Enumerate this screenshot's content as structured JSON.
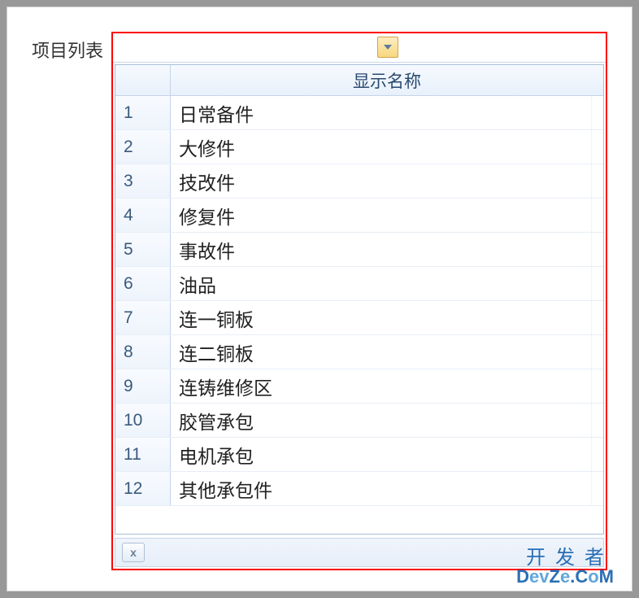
{
  "label": "项目列表",
  "combo": {
    "value": ""
  },
  "grid": {
    "header": {
      "display_name": "显示名称"
    },
    "rows": [
      {
        "idx": "1",
        "name": "日常备件"
      },
      {
        "idx": "2",
        "name": "大修件"
      },
      {
        "idx": "3",
        "name": "技改件"
      },
      {
        "idx": "4",
        "name": "修复件"
      },
      {
        "idx": "5",
        "name": "事故件"
      },
      {
        "idx": "6",
        "name": "油品"
      },
      {
        "idx": "7",
        "name": "连一铜板"
      },
      {
        "idx": "8",
        "name": "连二铜板"
      },
      {
        "idx": "9",
        "name": "连铸维修区"
      },
      {
        "idx": "10",
        "name": "胶管承包"
      },
      {
        "idx": "11",
        "name": "电机承包"
      },
      {
        "idx": "12",
        "name": "其他承包件"
      }
    ]
  },
  "footer": {
    "close_text": "x"
  },
  "watermark": {
    "line1": "开发者",
    "line2_a": "D",
    "line2_b": "ev",
    "line2_c": "Z",
    "line2_d": "e",
    "line2_e": ".C",
    "line2_f": "o",
    "line2_g": "M"
  }
}
